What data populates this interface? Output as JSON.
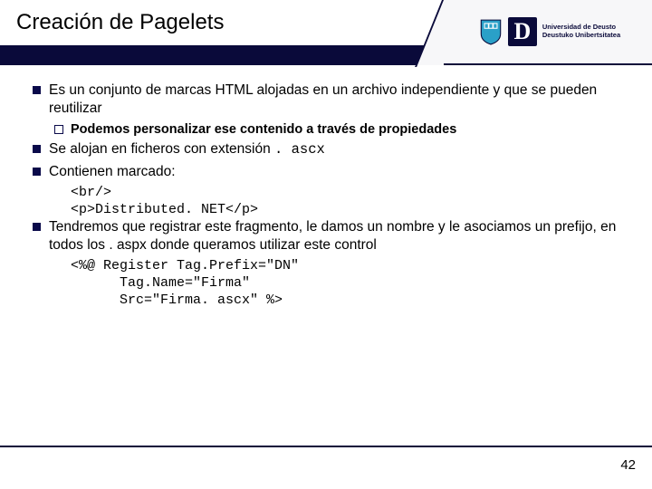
{
  "header": {
    "title": "Creación de Pagelets",
    "logo": {
      "letter": "D",
      "line1": "Universidad de Deusto",
      "line2": "Deustuko Unibertsitatea"
    }
  },
  "bullets": {
    "b1_text": "Es un conjunto de marcas HTML alojadas en un archivo independiente y que se pueden reutilizar",
    "b1_sub": "Podemos personalizar ese contenido a través de propiedades",
    "b2_prefix": "Se alojan en ficheros con extensión ",
    "b2_code": ". ascx",
    "b3_text": "Contienen marcado:",
    "b3_code": "<br/>\n<p>Distributed. NET</p>",
    "b4_text": "Tendremos que registrar este fragmento, le damos un nombre y le asociamos un prefijo, en todos los . aspx donde queramos utilizar este control",
    "b4_code": "<%@ Register Tag.Prefix=\"DN\"\n      Tag.Name=\"Firma\"\n      Src=\"Firma. ascx\" %>"
  },
  "pagenum": "42"
}
